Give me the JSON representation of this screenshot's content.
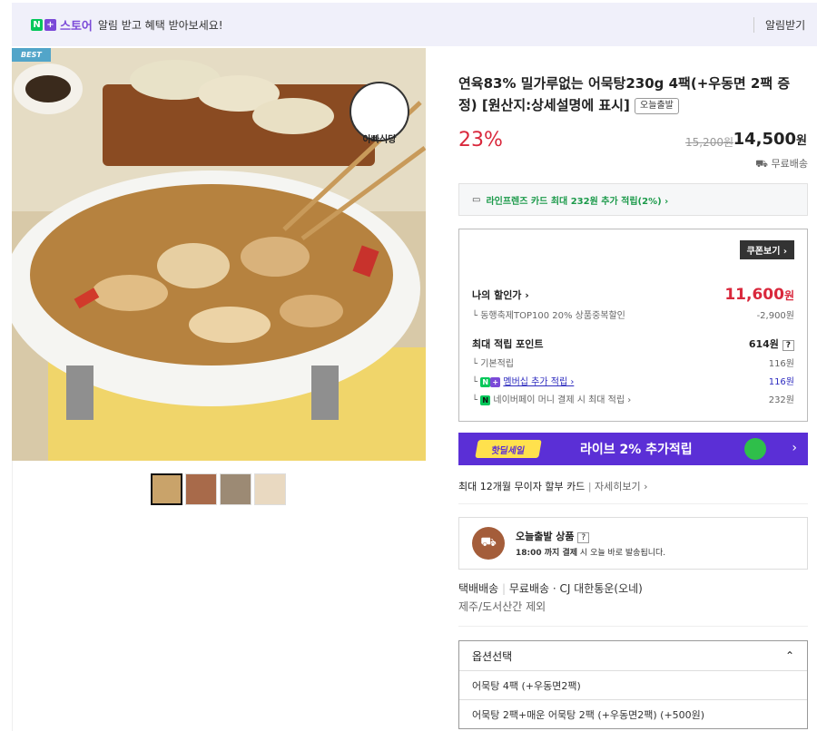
{
  "banner": {
    "badge_n": "N",
    "badge_plus": "+",
    "store": "스토어",
    "message": "알림 받고 혜택 받아보세요!",
    "right_label": "알림받기"
  },
  "product": {
    "badge": "BEST",
    "brand_logo_text": "아빠식당",
    "title": "연육83% 밀가루없는 어묵탕230g 4팩(+우동면 2팩 증정) [원산지:상세설명에 표시]",
    "tag": "오늘출발",
    "discount": "23%",
    "original_price": "15,200원",
    "price": "14,500",
    "price_unit": "원",
    "shipping": "무료배송"
  },
  "card_benefit": "라인프렌즈 카드 최대 232원 추가 적립(2%) ›",
  "benefit_box": {
    "coupon_button": "쿠폰보기 ›",
    "my_price_label": "나의 할인가 ›",
    "my_price": "11,600",
    "my_price_unit": "원",
    "promo_label": "동행축제TOP100 20% 상품중복할인",
    "promo_amount": "-2,900원",
    "points_label": "최대 적립 포인트",
    "points_value": "614원",
    "points_help": "?",
    "basic_label": "기본적립",
    "basic_value": "116원",
    "member_label": "멤버십 추가 적립 ›",
    "member_value": "116원",
    "npay_label": "네이버페이 머니 결제 시 최대 적립 ›",
    "npay_value": "232원"
  },
  "live_banner": {
    "logo": "핫딜세일",
    "text": "라이브 2% 추가적립",
    "arrow": "›"
  },
  "installment": {
    "text": "최대 12개월 무이자 할부 카드",
    "link": "자세히보기 ›"
  },
  "today": {
    "title": "오늘출발 상품",
    "help": "?",
    "deadline_time": "18:00 까지 결제",
    "desc": "시 오늘 바로 발송됩니다."
  },
  "delivery": {
    "type": "택배배송",
    "fee": "무료배송",
    "carrier": "CJ 대한통운(오네)",
    "exclude": "제주/도서산간 제외"
  },
  "options": {
    "header": "옵션선택",
    "items": [
      "어묵탕 4팩 (+우동면2팩)",
      "어묵탕 2팩+매운 어묵탕 2팩 (+우동면2팩) (+500원)"
    ]
  },
  "colors": {
    "accent_red": "#d9283c",
    "naver_green": "#03c75a",
    "purple": "#5b2fd6"
  }
}
